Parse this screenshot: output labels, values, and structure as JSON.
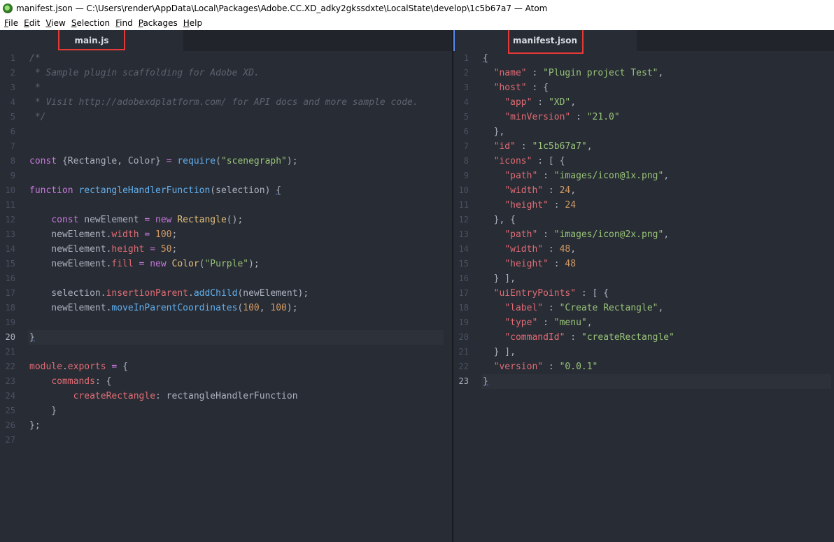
{
  "window": {
    "title": "manifest.json — C:\\Users\\render\\AppData\\Local\\Packages\\Adobe.CC.XD_adky2gkssdxte\\LocalState\\develop\\1c5b67a7 — Atom"
  },
  "menu": [
    "File",
    "Edit",
    "View",
    "Selection",
    "Find",
    "Packages",
    "Help"
  ],
  "colors": {
    "comment": "#5c6370",
    "keyword": "#c678dd",
    "function": "#61afef",
    "string": "#98c379",
    "number": "#d19a66",
    "property": "#e06c75",
    "class": "#e5c07b",
    "highlight_box": "#e53935"
  },
  "left_pane": {
    "tab_label": "main.js",
    "active_line": 20,
    "lines": [
      [
        [
          "/*",
          "comment"
        ]
      ],
      [
        [
          " * Sample plugin scaffolding for Adobe XD.",
          "comment"
        ]
      ],
      [
        [
          " *",
          "comment"
        ]
      ],
      [
        [
          " * Visit http://adobexdplatform.com/ for API docs and more sample code.",
          "comment"
        ]
      ],
      [
        [
          " */",
          "comment"
        ]
      ],
      [],
      [],
      [
        [
          "const",
          "keyword"
        ],
        [
          " {Rectangle, Color} ",
          "plain"
        ],
        [
          "=",
          "keyword"
        ],
        [
          " ",
          "plain"
        ],
        [
          "require",
          "function"
        ],
        [
          "(",
          "plain"
        ],
        [
          "\"scenegraph\"",
          "string"
        ],
        [
          ");",
          "plain"
        ]
      ],
      [],
      [
        [
          "function",
          "keyword"
        ],
        [
          " ",
          "plain"
        ],
        [
          "rectangleHandlerFunction",
          "function"
        ],
        [
          "(selection) ",
          "plain"
        ],
        [
          "{",
          "brace"
        ]
      ],
      [],
      [
        [
          "    ",
          "plain"
        ],
        [
          "const",
          "keyword"
        ],
        [
          " newElement ",
          "plain"
        ],
        [
          "=",
          "keyword"
        ],
        [
          " ",
          "plain"
        ],
        [
          "new",
          "keyword"
        ],
        [
          " ",
          "plain"
        ],
        [
          "Rectangle",
          "class"
        ],
        [
          "();",
          "plain"
        ]
      ],
      [
        [
          "    newElement.",
          "plain"
        ],
        [
          "width",
          "property"
        ],
        [
          " ",
          "plain"
        ],
        [
          "=",
          "keyword"
        ],
        [
          " ",
          "plain"
        ],
        [
          "100",
          "number"
        ],
        [
          ";",
          "plain"
        ]
      ],
      [
        [
          "    newElement.",
          "plain"
        ],
        [
          "height",
          "property"
        ],
        [
          " ",
          "plain"
        ],
        [
          "=",
          "keyword"
        ],
        [
          " ",
          "plain"
        ],
        [
          "50",
          "number"
        ],
        [
          ";",
          "plain"
        ]
      ],
      [
        [
          "    newElement.",
          "plain"
        ],
        [
          "fill",
          "property"
        ],
        [
          " ",
          "plain"
        ],
        [
          "=",
          "keyword"
        ],
        [
          " ",
          "plain"
        ],
        [
          "new",
          "keyword"
        ],
        [
          " ",
          "plain"
        ],
        [
          "Color",
          "class"
        ],
        [
          "(",
          "plain"
        ],
        [
          "\"Purple\"",
          "string"
        ],
        [
          ");",
          "plain"
        ]
      ],
      [],
      [
        [
          "    selection.",
          "plain"
        ],
        [
          "insertionParent",
          "property"
        ],
        [
          ".",
          "plain"
        ],
        [
          "addChild",
          "function"
        ],
        [
          "(newElement);",
          "plain"
        ]
      ],
      [
        [
          "    newElement.",
          "plain"
        ],
        [
          "moveInParentCoordinates",
          "function"
        ],
        [
          "(",
          "plain"
        ],
        [
          "100",
          "number"
        ],
        [
          ", ",
          "plain"
        ],
        [
          "100",
          "number"
        ],
        [
          ");",
          "plain"
        ]
      ],
      [],
      [
        [
          "}",
          "brace"
        ]
      ],
      [],
      [
        [
          "module",
          "property"
        ],
        [
          ".",
          "plain"
        ],
        [
          "exports",
          "property"
        ],
        [
          " ",
          "plain"
        ],
        [
          "=",
          "keyword"
        ],
        [
          " {",
          "plain"
        ]
      ],
      [
        [
          "    ",
          "plain"
        ],
        [
          "commands",
          "property"
        ],
        [
          ": {",
          "plain"
        ]
      ],
      [
        [
          "        ",
          "plain"
        ],
        [
          "createRectangle",
          "property"
        ],
        [
          ": rectangleHandlerFunction",
          "plain"
        ]
      ],
      [
        [
          "    }",
          "plain"
        ]
      ],
      [
        [
          "};",
          "plain"
        ]
      ],
      []
    ]
  },
  "right_pane": {
    "tab_label": "manifest.json",
    "active_line": 23,
    "lines": [
      [
        [
          "{",
          "brace"
        ]
      ],
      [
        [
          "  ",
          "plain"
        ],
        [
          "\"name\"",
          "property"
        ],
        [
          " : ",
          "plain"
        ],
        [
          "\"Plugin project Test\"",
          "string"
        ],
        [
          ",",
          "plain"
        ]
      ],
      [
        [
          "  ",
          "plain"
        ],
        [
          "\"host\"",
          "property"
        ],
        [
          " : {",
          "plain"
        ]
      ],
      [
        [
          "    ",
          "plain"
        ],
        [
          "\"app\"",
          "property"
        ],
        [
          " : ",
          "plain"
        ],
        [
          "\"XD\"",
          "string"
        ],
        [
          ",",
          "plain"
        ]
      ],
      [
        [
          "    ",
          "plain"
        ],
        [
          "\"minVersion\"",
          "property"
        ],
        [
          " : ",
          "plain"
        ],
        [
          "\"21.0\"",
          "string"
        ]
      ],
      [
        [
          "  },",
          "plain"
        ]
      ],
      [
        [
          "  ",
          "plain"
        ],
        [
          "\"id\"",
          "property"
        ],
        [
          " : ",
          "plain"
        ],
        [
          "\"1c5b67a7\"",
          "string"
        ],
        [
          ",",
          "plain"
        ]
      ],
      [
        [
          "  ",
          "plain"
        ],
        [
          "\"icons\"",
          "property"
        ],
        [
          " : [ {",
          "plain"
        ]
      ],
      [
        [
          "    ",
          "plain"
        ],
        [
          "\"path\"",
          "property"
        ],
        [
          " : ",
          "plain"
        ],
        [
          "\"images/icon@1x.png\"",
          "string"
        ],
        [
          ",",
          "plain"
        ]
      ],
      [
        [
          "    ",
          "plain"
        ],
        [
          "\"width\"",
          "property"
        ],
        [
          " : ",
          "plain"
        ],
        [
          "24",
          "number"
        ],
        [
          ",",
          "plain"
        ]
      ],
      [
        [
          "    ",
          "plain"
        ],
        [
          "\"height\"",
          "property"
        ],
        [
          " : ",
          "plain"
        ],
        [
          "24",
          "number"
        ]
      ],
      [
        [
          "  }, {",
          "plain"
        ]
      ],
      [
        [
          "    ",
          "plain"
        ],
        [
          "\"path\"",
          "property"
        ],
        [
          " : ",
          "plain"
        ],
        [
          "\"images/icon@2x.png\"",
          "string"
        ],
        [
          ",",
          "plain"
        ]
      ],
      [
        [
          "    ",
          "plain"
        ],
        [
          "\"width\"",
          "property"
        ],
        [
          " : ",
          "plain"
        ],
        [
          "48",
          "number"
        ],
        [
          ",",
          "plain"
        ]
      ],
      [
        [
          "    ",
          "plain"
        ],
        [
          "\"height\"",
          "property"
        ],
        [
          " : ",
          "plain"
        ],
        [
          "48",
          "number"
        ]
      ],
      [
        [
          "  } ],",
          "plain"
        ]
      ],
      [
        [
          "  ",
          "plain"
        ],
        [
          "\"uiEntryPoints\"",
          "property"
        ],
        [
          " : [ {",
          "plain"
        ]
      ],
      [
        [
          "    ",
          "plain"
        ],
        [
          "\"label\"",
          "property"
        ],
        [
          " : ",
          "plain"
        ],
        [
          "\"Create Rectangle\"",
          "string"
        ],
        [
          ",",
          "plain"
        ]
      ],
      [
        [
          "    ",
          "plain"
        ],
        [
          "\"type\"",
          "property"
        ],
        [
          " : ",
          "plain"
        ],
        [
          "\"menu\"",
          "string"
        ],
        [
          ",",
          "plain"
        ]
      ],
      [
        [
          "    ",
          "plain"
        ],
        [
          "\"commandId\"",
          "property"
        ],
        [
          " : ",
          "plain"
        ],
        [
          "\"createRectangle\"",
          "string"
        ]
      ],
      [
        [
          "  } ],",
          "plain"
        ]
      ],
      [
        [
          "  ",
          "plain"
        ],
        [
          "\"version\"",
          "property"
        ],
        [
          " : ",
          "plain"
        ],
        [
          "\"0.0.1\"",
          "string"
        ]
      ],
      [
        [
          "}",
          "brace"
        ]
      ]
    ]
  }
}
